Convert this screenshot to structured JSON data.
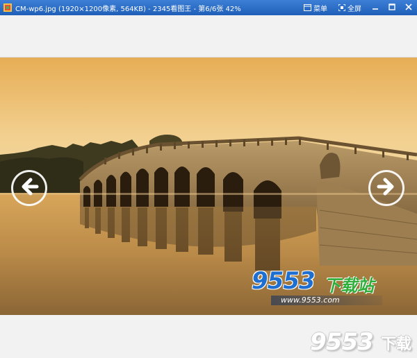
{
  "window": {
    "title": "CM-wp6.jpg (1920×1200像素, 564KB) - 2345看图王 - 第6/6张 42%",
    "menu_label": "菜单",
    "fullscreen_label": "全屏"
  },
  "viewer": {
    "image_subject": "seventeen-arch-bridge-sunset",
    "prev_icon": "arrow-left-icon",
    "next_icon": "arrow-right-icon"
  },
  "watermark": {
    "brand": "9553",
    "brand_cn": "下载站",
    "url": "www.9553.com"
  },
  "corner_logo": {
    "brand": "9553",
    "brand_cn": "下载"
  },
  "colors": {
    "titlebar": "#2a6cc8",
    "sky_top": "#e8b25a",
    "sky_bottom": "#f3d79a",
    "bridge_stone": "#8a6a3c"
  }
}
